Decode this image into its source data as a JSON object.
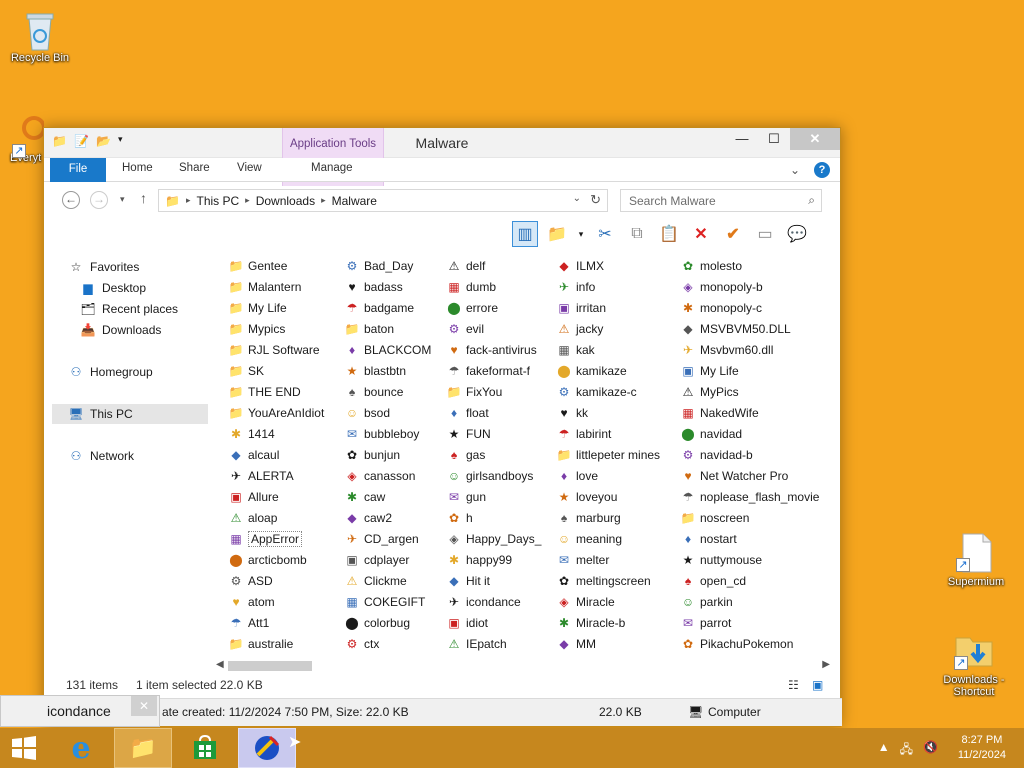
{
  "desktop": {
    "icons": [
      {
        "label": "Recycle Bin",
        "icon": "recycle-bin-icon"
      },
      {
        "label": "Everyt",
        "icon": "everything-search-icon"
      },
      {
        "label": "Supermium",
        "icon": "document-icon"
      },
      {
        "label": "Downloads - Shortcut",
        "icon": "folder-download-icon"
      }
    ]
  },
  "window": {
    "title": "Malware",
    "app_tools_label": "Application Tools",
    "tabs": [
      "File",
      "Home",
      "Share",
      "View",
      "Manage"
    ],
    "buttons": {
      "minimize": "—",
      "maximize": "☐",
      "close": "✕"
    },
    "address": {
      "root": "This PC",
      "parts": [
        "Downloads",
        "Malware"
      ]
    },
    "search_placeholder": "Search Malware"
  },
  "nav": {
    "favorites": "Favorites",
    "desktop": "Desktop",
    "recent": "Recent places",
    "downloads": "Downloads",
    "homegroup": "Homegroup",
    "thispc": "This PC",
    "network": "Network"
  },
  "files": {
    "col1": [
      "Gentee",
      "Malantern",
      "My Life",
      "Mypics",
      "RJL Software",
      "SK",
      "THE END",
      "YouAreAnIdiot",
      "1414",
      "alcaul",
      "ALERTA",
      "Allure",
      "aloap",
      "AppError",
      "arcticbomb",
      "ASD",
      "atom",
      "Att1",
      "australie"
    ],
    "col2": [
      "Bad_Day",
      "badass",
      "badgame",
      "baton",
      "BLACKCOM",
      "blastbtn",
      "bounce",
      "bsod",
      "bubbleboy",
      "bunjun",
      "canasson",
      "caw",
      "caw2",
      "CD_argen",
      "cdplayer",
      "Clickme",
      "COKEGIFT",
      "colorbug",
      "ctx"
    ],
    "col3": [
      "delf",
      "dumb",
      "errore",
      "evil",
      "fack-antivirus",
      "fakeformat-f",
      "FixYou",
      "float",
      "FUN",
      "gas",
      "girlsandboys",
      "gun",
      "h",
      "Happy_Days_",
      "happy99",
      "Hit it",
      "icondance",
      "idiot",
      "IEpatch"
    ],
    "col4": [
      "ILMX",
      "info",
      "irritan",
      "jacky",
      "kak",
      "kamikaze",
      "kamikaze-c",
      "kk",
      "labirint",
      "littlepeter mines",
      "love",
      "loveyou",
      "marburg",
      "meaning",
      "melter",
      "meltingscreen",
      "Miracle",
      "Miracle-b",
      "MM"
    ],
    "col5": [
      "molesto",
      "monopoly-b",
      "monopoly-c",
      "MSVBVM50.DLL",
      "Msvbvm60.dll",
      "My Life",
      "MyPics",
      "NakedWife",
      "navidad",
      "navidad-b",
      "Net Watcher Pro",
      "noplease_flash_movie",
      "noscreen",
      "nostart",
      "nuttymouse",
      "open_cd",
      "parkin",
      "parrot",
      "PikachuPokemon"
    ]
  },
  "status": {
    "items": "131 items",
    "selected": "1 item selected",
    "size": "22.0 KB",
    "details": "ate created: 11/2/2024 7:50 PM, Size: 22.0 KB",
    "size2": "22.0 KB",
    "location": "Computer"
  },
  "tooltip": "icondance",
  "taskbar": {
    "time": "8:27 PM",
    "date": "11/2/2024"
  },
  "colors": {
    "accent": "#1979ca",
    "desktop": "#f5a51e",
    "taskbar": "#c6871e"
  }
}
